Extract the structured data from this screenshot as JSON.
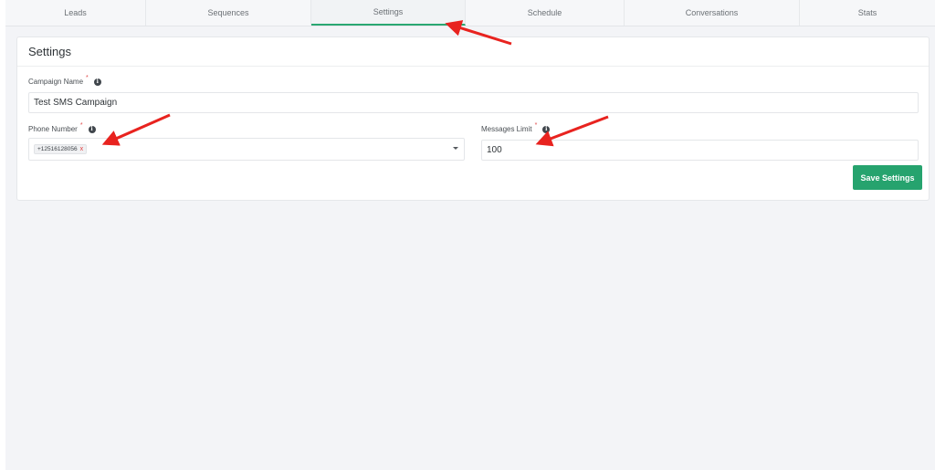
{
  "tabs": [
    {
      "label": "Leads"
    },
    {
      "label": "Sequences"
    },
    {
      "label": "Settings"
    },
    {
      "label": "Schedule"
    },
    {
      "label": "Conversations"
    },
    {
      "label": "Stats"
    }
  ],
  "settings": {
    "title": "Settings",
    "campaign_name_label": "Campaign Name",
    "campaign_name_value": "Test SMS Campaign",
    "phone_number_label": "Phone Number",
    "phone_number_tag": "+12516128056",
    "phone_number_tag_remove": "x",
    "messages_limit_label": "Messages Limit",
    "messages_limit_value": "100",
    "required_marker": "*",
    "info_glyph": "i",
    "save_label": "Save Settings"
  },
  "colors": {
    "accent": "#26a36e",
    "annotation_arrow": "#e8231f",
    "page_background": "#f3f4f7"
  },
  "annotations": {
    "arrow_count": 3
  }
}
